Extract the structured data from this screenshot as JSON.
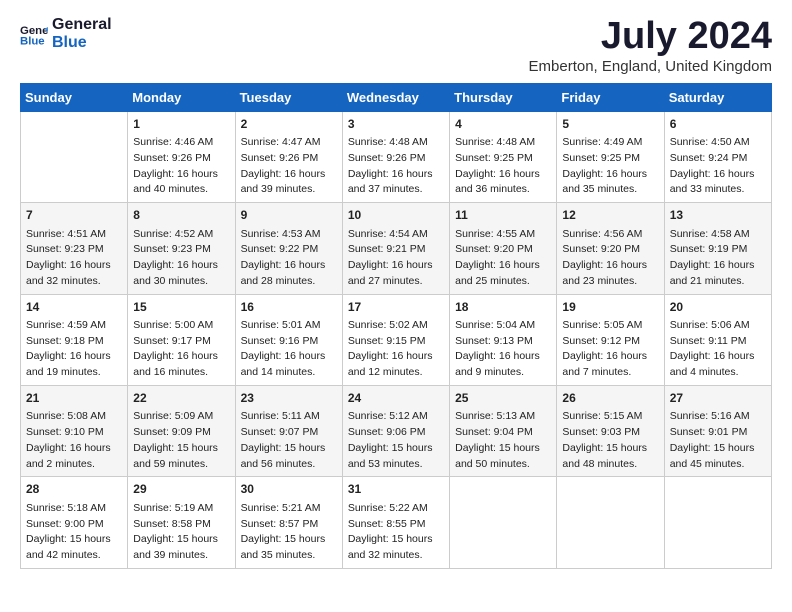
{
  "header": {
    "logo_line1": "General",
    "logo_line2": "Blue",
    "title": "July 2024",
    "subtitle": "Emberton, England, United Kingdom"
  },
  "calendar": {
    "days_of_week": [
      "Sunday",
      "Monday",
      "Tuesday",
      "Wednesday",
      "Thursday",
      "Friday",
      "Saturday"
    ],
    "weeks": [
      [
        {
          "day": "",
          "content": ""
        },
        {
          "day": "1",
          "content": "Sunrise: 4:46 AM\nSunset: 9:26 PM\nDaylight: 16 hours\nand 40 minutes."
        },
        {
          "day": "2",
          "content": "Sunrise: 4:47 AM\nSunset: 9:26 PM\nDaylight: 16 hours\nand 39 minutes."
        },
        {
          "day": "3",
          "content": "Sunrise: 4:48 AM\nSunset: 9:26 PM\nDaylight: 16 hours\nand 37 minutes."
        },
        {
          "day": "4",
          "content": "Sunrise: 4:48 AM\nSunset: 9:25 PM\nDaylight: 16 hours\nand 36 minutes."
        },
        {
          "day": "5",
          "content": "Sunrise: 4:49 AM\nSunset: 9:25 PM\nDaylight: 16 hours\nand 35 minutes."
        },
        {
          "day": "6",
          "content": "Sunrise: 4:50 AM\nSunset: 9:24 PM\nDaylight: 16 hours\nand 33 minutes."
        }
      ],
      [
        {
          "day": "7",
          "content": "Sunrise: 4:51 AM\nSunset: 9:23 PM\nDaylight: 16 hours\nand 32 minutes."
        },
        {
          "day": "8",
          "content": "Sunrise: 4:52 AM\nSunset: 9:23 PM\nDaylight: 16 hours\nand 30 minutes."
        },
        {
          "day": "9",
          "content": "Sunrise: 4:53 AM\nSunset: 9:22 PM\nDaylight: 16 hours\nand 28 minutes."
        },
        {
          "day": "10",
          "content": "Sunrise: 4:54 AM\nSunset: 9:21 PM\nDaylight: 16 hours\nand 27 minutes."
        },
        {
          "day": "11",
          "content": "Sunrise: 4:55 AM\nSunset: 9:20 PM\nDaylight: 16 hours\nand 25 minutes."
        },
        {
          "day": "12",
          "content": "Sunrise: 4:56 AM\nSunset: 9:20 PM\nDaylight: 16 hours\nand 23 minutes."
        },
        {
          "day": "13",
          "content": "Sunrise: 4:58 AM\nSunset: 9:19 PM\nDaylight: 16 hours\nand 21 minutes."
        }
      ],
      [
        {
          "day": "14",
          "content": "Sunrise: 4:59 AM\nSunset: 9:18 PM\nDaylight: 16 hours\nand 19 minutes."
        },
        {
          "day": "15",
          "content": "Sunrise: 5:00 AM\nSunset: 9:17 PM\nDaylight: 16 hours\nand 16 minutes."
        },
        {
          "day": "16",
          "content": "Sunrise: 5:01 AM\nSunset: 9:16 PM\nDaylight: 16 hours\nand 14 minutes."
        },
        {
          "day": "17",
          "content": "Sunrise: 5:02 AM\nSunset: 9:15 PM\nDaylight: 16 hours\nand 12 minutes."
        },
        {
          "day": "18",
          "content": "Sunrise: 5:04 AM\nSunset: 9:13 PM\nDaylight: 16 hours\nand 9 minutes."
        },
        {
          "day": "19",
          "content": "Sunrise: 5:05 AM\nSunset: 9:12 PM\nDaylight: 16 hours\nand 7 minutes."
        },
        {
          "day": "20",
          "content": "Sunrise: 5:06 AM\nSunset: 9:11 PM\nDaylight: 16 hours\nand 4 minutes."
        }
      ],
      [
        {
          "day": "21",
          "content": "Sunrise: 5:08 AM\nSunset: 9:10 PM\nDaylight: 16 hours\nand 2 minutes."
        },
        {
          "day": "22",
          "content": "Sunrise: 5:09 AM\nSunset: 9:09 PM\nDaylight: 15 hours\nand 59 minutes."
        },
        {
          "day": "23",
          "content": "Sunrise: 5:11 AM\nSunset: 9:07 PM\nDaylight: 15 hours\nand 56 minutes."
        },
        {
          "day": "24",
          "content": "Sunrise: 5:12 AM\nSunset: 9:06 PM\nDaylight: 15 hours\nand 53 minutes."
        },
        {
          "day": "25",
          "content": "Sunrise: 5:13 AM\nSunset: 9:04 PM\nDaylight: 15 hours\nand 50 minutes."
        },
        {
          "day": "26",
          "content": "Sunrise: 5:15 AM\nSunset: 9:03 PM\nDaylight: 15 hours\nand 48 minutes."
        },
        {
          "day": "27",
          "content": "Sunrise: 5:16 AM\nSunset: 9:01 PM\nDaylight: 15 hours\nand 45 minutes."
        }
      ],
      [
        {
          "day": "28",
          "content": "Sunrise: 5:18 AM\nSunset: 9:00 PM\nDaylight: 15 hours\nand 42 minutes."
        },
        {
          "day": "29",
          "content": "Sunrise: 5:19 AM\nSunset: 8:58 PM\nDaylight: 15 hours\nand 39 minutes."
        },
        {
          "day": "30",
          "content": "Sunrise: 5:21 AM\nSunset: 8:57 PM\nDaylight: 15 hours\nand 35 minutes."
        },
        {
          "day": "31",
          "content": "Sunrise: 5:22 AM\nSunset: 8:55 PM\nDaylight: 15 hours\nand 32 minutes."
        },
        {
          "day": "",
          "content": ""
        },
        {
          "day": "",
          "content": ""
        },
        {
          "day": "",
          "content": ""
        }
      ]
    ]
  }
}
